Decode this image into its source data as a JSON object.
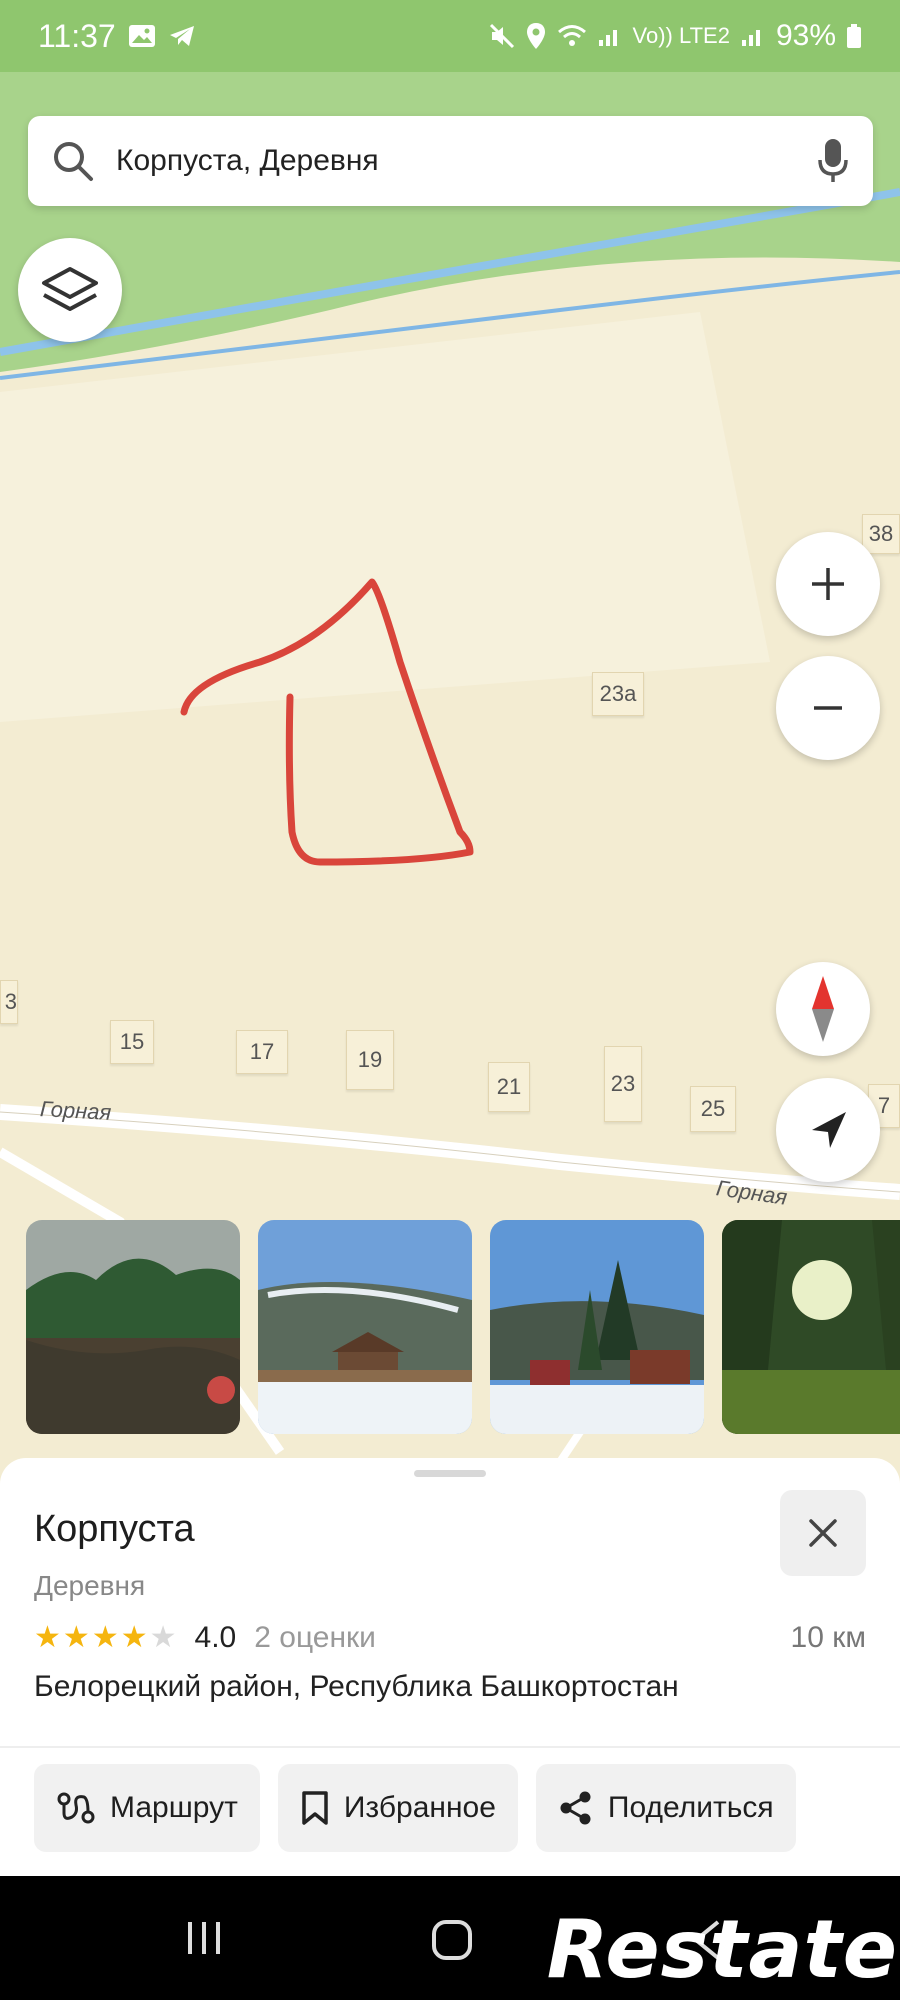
{
  "status_bar": {
    "time": "11:37",
    "volte": "Vo)) LTE2",
    "battery": "93%"
  },
  "search": {
    "query": "Корпуста, Деревня"
  },
  "map": {
    "house_numbers": [
      "38",
      "23а",
      "15",
      "17",
      "19",
      "21",
      "23",
      "25",
      "7",
      "3"
    ],
    "streets": [
      "Горная",
      "Горная"
    ]
  },
  "place": {
    "title": "Корпуста",
    "subtitle": "Деревня",
    "rating_value": "4.0",
    "rating_stars": 4,
    "rating_count": "2 оценки",
    "distance": "10 км",
    "address": "Белорецкий район, Республика Башкортостан"
  },
  "actions": {
    "route": "Маршрут",
    "favorite": "Избранное",
    "share": "Поделиться"
  },
  "watermark": "Restate",
  "icons": [
    "search-icon",
    "mic-icon",
    "layers-icon",
    "zoom-in-icon",
    "zoom-out-icon",
    "compass-icon",
    "locate-icon",
    "close-icon",
    "route-icon",
    "bookmark-icon",
    "share-icon"
  ],
  "colors": {
    "map_green": "#8fc66e",
    "map_land": "#f3ecd2",
    "river": "#8ec3ea",
    "drawn_outline": "#d9453b",
    "star": "#f5b50f"
  }
}
